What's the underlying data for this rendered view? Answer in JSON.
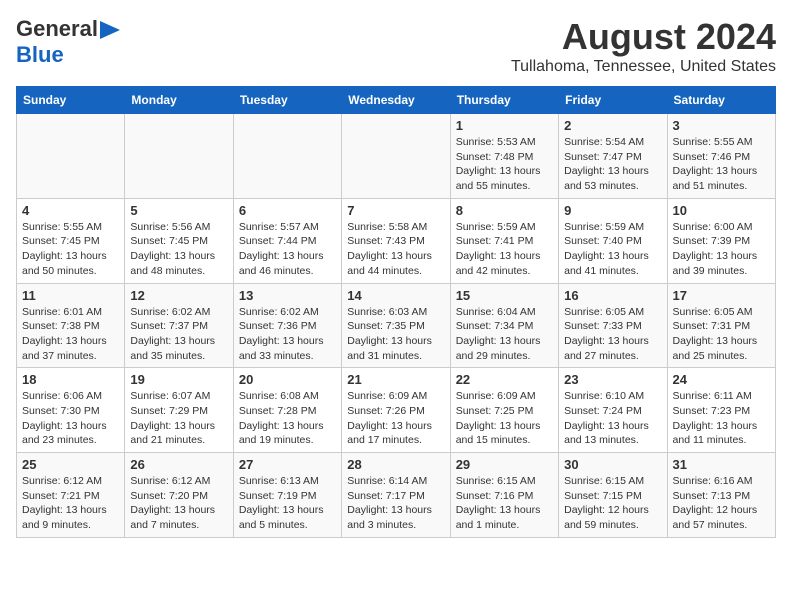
{
  "header": {
    "logo_line1": "General",
    "logo_line2": "Blue",
    "title": "August 2024",
    "subtitle": "Tullahoma, Tennessee, United States"
  },
  "days_of_week": [
    "Sunday",
    "Monday",
    "Tuesday",
    "Wednesday",
    "Thursday",
    "Friday",
    "Saturday"
  ],
  "weeks": [
    [
      {
        "day": "",
        "info": ""
      },
      {
        "day": "",
        "info": ""
      },
      {
        "day": "",
        "info": ""
      },
      {
        "day": "",
        "info": ""
      },
      {
        "day": "1",
        "info": "Sunrise: 5:53 AM\nSunset: 7:48 PM\nDaylight: 13 hours\nand 55 minutes."
      },
      {
        "day": "2",
        "info": "Sunrise: 5:54 AM\nSunset: 7:47 PM\nDaylight: 13 hours\nand 53 minutes."
      },
      {
        "day": "3",
        "info": "Sunrise: 5:55 AM\nSunset: 7:46 PM\nDaylight: 13 hours\nand 51 minutes."
      }
    ],
    [
      {
        "day": "4",
        "info": "Sunrise: 5:55 AM\nSunset: 7:45 PM\nDaylight: 13 hours\nand 50 minutes."
      },
      {
        "day": "5",
        "info": "Sunrise: 5:56 AM\nSunset: 7:45 PM\nDaylight: 13 hours\nand 48 minutes."
      },
      {
        "day": "6",
        "info": "Sunrise: 5:57 AM\nSunset: 7:44 PM\nDaylight: 13 hours\nand 46 minutes."
      },
      {
        "day": "7",
        "info": "Sunrise: 5:58 AM\nSunset: 7:43 PM\nDaylight: 13 hours\nand 44 minutes."
      },
      {
        "day": "8",
        "info": "Sunrise: 5:59 AM\nSunset: 7:41 PM\nDaylight: 13 hours\nand 42 minutes."
      },
      {
        "day": "9",
        "info": "Sunrise: 5:59 AM\nSunset: 7:40 PM\nDaylight: 13 hours\nand 41 minutes."
      },
      {
        "day": "10",
        "info": "Sunrise: 6:00 AM\nSunset: 7:39 PM\nDaylight: 13 hours\nand 39 minutes."
      }
    ],
    [
      {
        "day": "11",
        "info": "Sunrise: 6:01 AM\nSunset: 7:38 PM\nDaylight: 13 hours\nand 37 minutes."
      },
      {
        "day": "12",
        "info": "Sunrise: 6:02 AM\nSunset: 7:37 PM\nDaylight: 13 hours\nand 35 minutes."
      },
      {
        "day": "13",
        "info": "Sunrise: 6:02 AM\nSunset: 7:36 PM\nDaylight: 13 hours\nand 33 minutes."
      },
      {
        "day": "14",
        "info": "Sunrise: 6:03 AM\nSunset: 7:35 PM\nDaylight: 13 hours\nand 31 minutes."
      },
      {
        "day": "15",
        "info": "Sunrise: 6:04 AM\nSunset: 7:34 PM\nDaylight: 13 hours\nand 29 minutes."
      },
      {
        "day": "16",
        "info": "Sunrise: 6:05 AM\nSunset: 7:33 PM\nDaylight: 13 hours\nand 27 minutes."
      },
      {
        "day": "17",
        "info": "Sunrise: 6:05 AM\nSunset: 7:31 PM\nDaylight: 13 hours\nand 25 minutes."
      }
    ],
    [
      {
        "day": "18",
        "info": "Sunrise: 6:06 AM\nSunset: 7:30 PM\nDaylight: 13 hours\nand 23 minutes."
      },
      {
        "day": "19",
        "info": "Sunrise: 6:07 AM\nSunset: 7:29 PM\nDaylight: 13 hours\nand 21 minutes."
      },
      {
        "day": "20",
        "info": "Sunrise: 6:08 AM\nSunset: 7:28 PM\nDaylight: 13 hours\nand 19 minutes."
      },
      {
        "day": "21",
        "info": "Sunrise: 6:09 AM\nSunset: 7:26 PM\nDaylight: 13 hours\nand 17 minutes."
      },
      {
        "day": "22",
        "info": "Sunrise: 6:09 AM\nSunset: 7:25 PM\nDaylight: 13 hours\nand 15 minutes."
      },
      {
        "day": "23",
        "info": "Sunrise: 6:10 AM\nSunset: 7:24 PM\nDaylight: 13 hours\nand 13 minutes."
      },
      {
        "day": "24",
        "info": "Sunrise: 6:11 AM\nSunset: 7:23 PM\nDaylight: 13 hours\nand 11 minutes."
      }
    ],
    [
      {
        "day": "25",
        "info": "Sunrise: 6:12 AM\nSunset: 7:21 PM\nDaylight: 13 hours\nand 9 minutes."
      },
      {
        "day": "26",
        "info": "Sunrise: 6:12 AM\nSunset: 7:20 PM\nDaylight: 13 hours\nand 7 minutes."
      },
      {
        "day": "27",
        "info": "Sunrise: 6:13 AM\nSunset: 7:19 PM\nDaylight: 13 hours\nand 5 minutes."
      },
      {
        "day": "28",
        "info": "Sunrise: 6:14 AM\nSunset: 7:17 PM\nDaylight: 13 hours\nand 3 minutes."
      },
      {
        "day": "29",
        "info": "Sunrise: 6:15 AM\nSunset: 7:16 PM\nDaylight: 13 hours\nand 1 minute."
      },
      {
        "day": "30",
        "info": "Sunrise: 6:15 AM\nSunset: 7:15 PM\nDaylight: 12 hours\nand 59 minutes."
      },
      {
        "day": "31",
        "info": "Sunrise: 6:16 AM\nSunset: 7:13 PM\nDaylight: 12 hours\nand 57 minutes."
      }
    ]
  ]
}
